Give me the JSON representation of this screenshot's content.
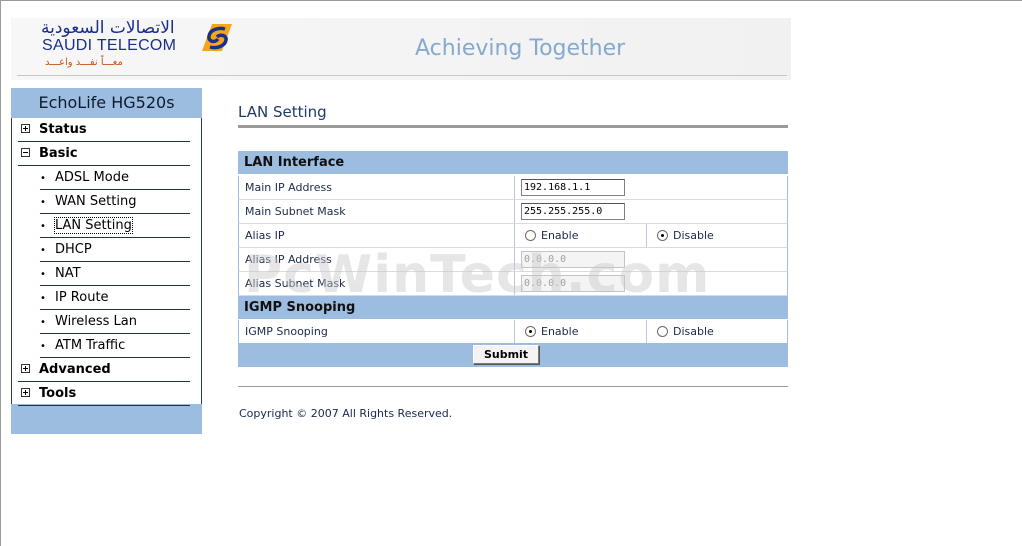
{
  "header": {
    "logo_arabic": "الاتصالات السعودية",
    "logo_text": "SAUDI TELECOM",
    "logo_tagline": "معـــاً نفـــد واعـــد",
    "slogan": "Achieving Together",
    "brand_colors": {
      "logo_blue": "#1a2f8a",
      "logo_orange": "#c5571c",
      "slogan": "#86a9cf"
    }
  },
  "sidebar": {
    "device_name": "EchoLife HG520s",
    "menu": [
      {
        "label": "Status",
        "level": "top",
        "icon": "plus-box-icon"
      },
      {
        "label": "Basic",
        "level": "top",
        "icon": "minus-box-icon"
      },
      {
        "label": "ADSL Mode",
        "level": "sub"
      },
      {
        "label": "WAN Setting",
        "level": "sub"
      },
      {
        "label": "LAN Setting",
        "level": "sub",
        "active": true
      },
      {
        "label": "DHCP",
        "level": "sub"
      },
      {
        "label": "NAT",
        "level": "sub"
      },
      {
        "label": "IP Route",
        "level": "sub"
      },
      {
        "label": "Wireless Lan",
        "level": "sub"
      },
      {
        "label": "ATM Traffic",
        "level": "sub"
      },
      {
        "label": "Advanced",
        "level": "top",
        "icon": "plus-box-icon"
      },
      {
        "label": "Tools",
        "level": "top",
        "icon": "plus-box-icon"
      }
    ]
  },
  "main": {
    "page_title": "LAN Setting",
    "lan_section": {
      "heading": "LAN Interface",
      "main_ip_label": "Main IP Address",
      "main_ip_value": "192.168.1.1",
      "main_mask_label": "Main Subnet Mask",
      "main_mask_value": "255.255.255.0",
      "alias_ip_label": "Alias IP",
      "alias_enable_label": "Enable",
      "alias_disable_label": "Disable",
      "alias_selected": "Disable",
      "alias_ip_addr_label": "Alias IP Address",
      "alias_ip_addr_value": "0.0.0.0",
      "alias_mask_label": "Alias Subnet Mask",
      "alias_mask_value": "0.0.0.0"
    },
    "igmp_section": {
      "heading": "IGMP Snooping",
      "igmp_label": "IGMP Snooping",
      "enable_label": "Enable",
      "disable_label": "Disable",
      "selected": "Enable"
    },
    "submit_label": "Submit",
    "copyright": "Copyright © 2007 All Rights Reserved."
  },
  "watermark": "PcWinTech.com",
  "colors": {
    "section_blue": "#9dbde0",
    "title_blue": "#1c3b66"
  }
}
